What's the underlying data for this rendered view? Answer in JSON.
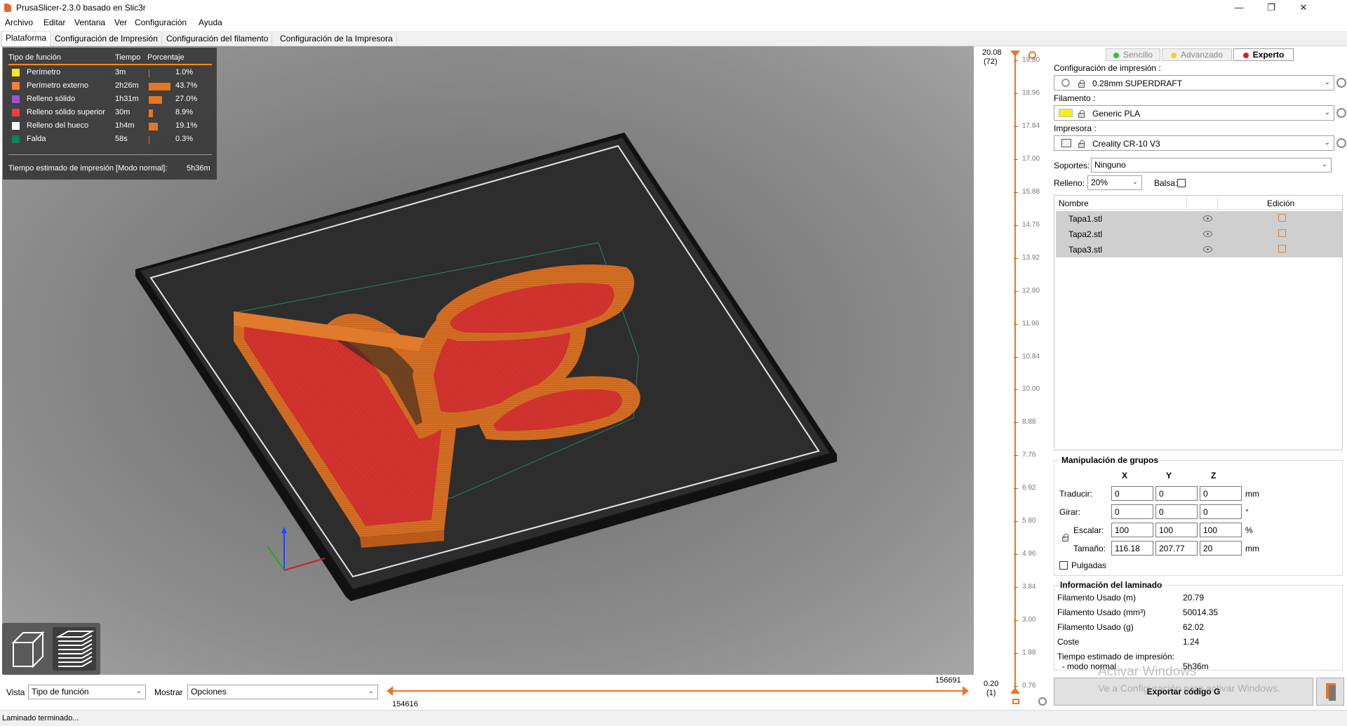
{
  "window": {
    "title": "PrusaSlicer-2.3.0 basado en Slic3r",
    "minimize": "—",
    "maximize": "❐",
    "close": "✕"
  },
  "menu": [
    "Archivo",
    "Editar",
    "Ventana",
    "Ver",
    "Configuración",
    "Ayuda"
  ],
  "tabs": [
    "Plataforma",
    "Configuración de Impresión",
    "Configuración del filamento",
    "Configuración de la Impresora"
  ],
  "legend": {
    "headers": {
      "type": "Tipo de función",
      "time": "Tiempo",
      "percent": "Porcentaje"
    },
    "rows": [
      {
        "name": "Perímetro",
        "time": "3m",
        "percent": "1.0%",
        "fraction": 0.01,
        "color": "#ffe61a"
      },
      {
        "name": "Perímetro externo",
        "time": "2h26m",
        "percent": "43.7%",
        "fraction": 0.437,
        "color": "#ff7d38"
      },
      {
        "name": "Relleno sólido",
        "time": "1h31m",
        "percent": "27.0%",
        "fraction": 0.27,
        "color": "#9954cc"
      },
      {
        "name": "Relleno sólido superior",
        "time": "30m",
        "percent": "8.9%",
        "fraction": 0.089,
        "color": "#f03c3c"
      },
      {
        "name": "Relleno del hueco",
        "time": "1h4m",
        "percent": "19.1%",
        "fraction": 0.191,
        "color": "#ffffff"
      },
      {
        "name": "Falda",
        "time": "58s",
        "percent": "0.3%",
        "fraction": 0.003,
        "color": "#00875a"
      }
    ],
    "total_label": "Tiempo estimado de impresión [Modo normal]:",
    "total_value": "5h36m"
  },
  "vertical_slider": {
    "top_value": "20.08",
    "top_layer": "(72)",
    "bottom_value": "0.20",
    "bottom_layer": "(1)",
    "ticks": [
      "19.80",
      "18.96",
      "17.84",
      "17.00",
      "15.88",
      "14.76",
      "13.92",
      "12.80",
      "11.96",
      "10.84",
      "10.00",
      "8.88",
      "7.76",
      "6.92",
      "5.80",
      "4.96",
      "3.84",
      "3.00",
      "1.88",
      "0.76"
    ]
  },
  "horizontal_slider": {
    "left_value": "154616",
    "right_value": "156691"
  },
  "bottom": {
    "view_label": "Vista",
    "view_value": "Tipo de función",
    "show_label": "Mostrar",
    "show_value": "Opciones"
  },
  "status": "Laminado terminado...",
  "sidebar": {
    "modes": [
      {
        "label": "Sencillo",
        "color": "#2fc32f",
        "active": false
      },
      {
        "label": "Advanzado",
        "color": "#f2d31a",
        "active": false
      },
      {
        "label": "Experto",
        "color": "#e61a1a",
        "active": true
      }
    ],
    "print_label": "Configuración de impresión :",
    "print_value": "0.28mm SUPERDRAFT",
    "filament_label": "Filamento :",
    "filament_value": "Generic PLA",
    "filament_color": "#f5ef1a",
    "printer_label": "Impresora :",
    "printer_value": "Creality CR-10 V3",
    "supports_label": "Soportes:",
    "supports_value": "Ninguno",
    "infill_label": "Relleno:",
    "infill_value": "20%",
    "raft_label": "Balsa:",
    "list_headers": {
      "name": "Nombre",
      "edit": "Edición"
    },
    "objects": [
      "Tapa1.stl",
      "Tapa2.stl",
      "Tapa3.stl"
    ],
    "manip": {
      "title": "Manipulación de grupos",
      "axes": [
        "X",
        "Y",
        "Z"
      ],
      "translate_label": "Traducir:",
      "translate": [
        "0",
        "0",
        "0"
      ],
      "translate_unit": "mm",
      "rotate_label": "Girar:",
      "rotate": [
        "0",
        "0",
        "0"
      ],
      "rotate_unit": "°",
      "scale_label": "Escalar:",
      "scale": [
        "100",
        "100",
        "100"
      ],
      "scale_unit": "%",
      "size_label": "Tamaño:",
      "size": [
        "116.18",
        "207.77",
        "20"
      ],
      "size_unit": "mm",
      "inches_label": "Pulgadas"
    },
    "info": {
      "title": "Información del laminado",
      "rows": [
        {
          "label": "Filamento Usado (m)",
          "value": "20.79"
        },
        {
          "label": "Filamento Usado (mm³)",
          "value": "50014.35"
        },
        {
          "label": "Filamento Usado (g)",
          "value": "62.02"
        },
        {
          "label": "Coste",
          "value": "1.24"
        },
        {
          "label": "Tiempo estimado de impresión:",
          "value": ""
        },
        {
          "label": "  - modo normal",
          "value": "5h36m"
        }
      ]
    },
    "export_label": "Exportar código G"
  },
  "watermark": {
    "title": "Activar Windows",
    "subtitle": "Ve a Configuración para activar Windows."
  }
}
